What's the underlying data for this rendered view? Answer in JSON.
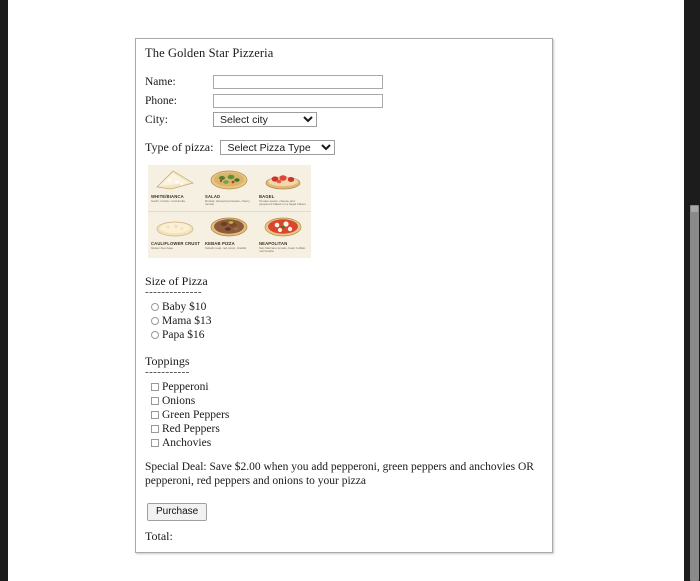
{
  "window": {
    "scrollbar": {
      "name": "vertical-scrollbar"
    }
  },
  "form": {
    "title": "The Golden Star Pizzeria",
    "fields": [
      {
        "label": "Name:",
        "value": "",
        "placeholder": "",
        "type": "text"
      },
      {
        "label": "Phone:",
        "value": "",
        "placeholder": "",
        "type": "text"
      }
    ],
    "city": {
      "label": "City:",
      "selected": "Select city"
    },
    "pizza_type": {
      "label": "Type of pizza:",
      "selected": "Select Pizza Type"
    },
    "poster": {
      "alt": "pizza-styles-infographic",
      "background": "#f6f0e2",
      "items": [
        {
          "title": "WHITE/BIANCA",
          "sub": "Garlic, ricotta, mozzarella"
        },
        {
          "title": "SALAD",
          "sub": "Rocket, shaved parmesan, cherry tomato"
        },
        {
          "title": "BAGEL",
          "sub": "Tomato sauce, cheese and pepperoni baked on a bagel halves"
        },
        {
          "title": "CAULIFLOWER CRUST",
          "sub": "Gluten free base"
        },
        {
          "title": "KEBAB PIZZA",
          "sub": "Kebab meat, red onion, tzatziki"
        },
        {
          "title": "NEAPOLITAN",
          "sub": "San Marzano tomato, basil, buffalo mozzarella"
        }
      ]
    },
    "size": {
      "heading": "Size of Pizza",
      "rule": "--------------",
      "options": [
        {
          "label": "Baby $10",
          "checked": false
        },
        {
          "label": "Mama $13",
          "checked": false
        },
        {
          "label": "Papa $16",
          "checked": false
        }
      ]
    },
    "toppings": {
      "heading": "Toppings",
      "rule": "-----------",
      "options": [
        {
          "label": "Pepperoni",
          "checked": false
        },
        {
          "label": "Onions",
          "checked": false
        },
        {
          "label": "Green Peppers",
          "checked": false
        },
        {
          "label": "Red Peppers",
          "checked": false
        },
        {
          "label": "Anchovies",
          "checked": false
        }
      ]
    },
    "special_deal": "Special Deal: Save $2.00 when you add pepperoni, green peppers and anchovies OR pepperoni, red peppers and onions to your pizza",
    "purchase_label": "Purchase",
    "total_label": "Total:",
    "total_value": ""
  }
}
